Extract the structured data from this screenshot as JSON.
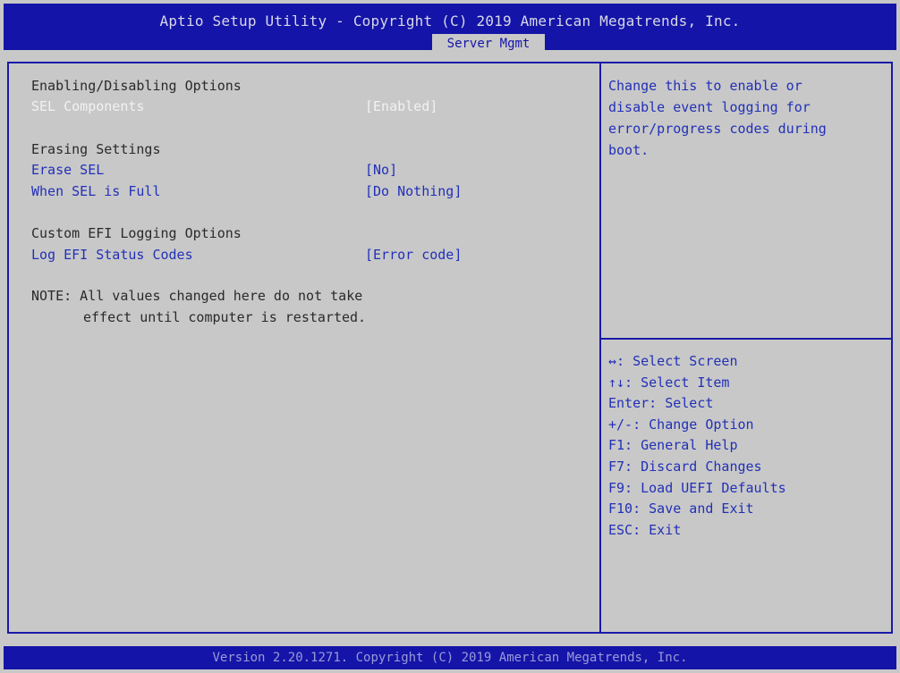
{
  "header": {
    "title": "Aptio Setup Utility - Copyright (C) 2019 American Megatrends, Inc.",
    "active_tab": "Server Mgmt"
  },
  "settings": {
    "section1_heading": "Enabling/Disabling Options",
    "sel_components_label": "SEL Components",
    "sel_components_value": "[Enabled]",
    "section2_heading": "Erasing Settings",
    "erase_sel_label": "Erase SEL",
    "erase_sel_value": "[No]",
    "when_full_label": "When SEL is Full",
    "when_full_value": "[Do Nothing]",
    "section3_heading": "Custom EFI Logging Options",
    "log_efi_label": "Log EFI Status Codes",
    "log_efi_value": "[Error code]",
    "note_line1": "NOTE: All values changed here do not take",
    "note_line2": "effect until computer is restarted."
  },
  "help": {
    "lines": [
      "Change this to enable or",
      "disable event logging for",
      "error/progress codes during",
      "boot."
    ]
  },
  "keys": [
    "↔: Select Screen",
    "↑↓: Select Item",
    "Enter: Select",
    "+/-: Change Option",
    "F1: General Help",
    "F7: Discard Changes",
    "F9: Load UEFI Defaults",
    "F10: Save and Exit",
    "ESC: Exit"
  ],
  "footer": {
    "text": "Version 2.20.1271. Copyright (C) 2019 American Megatrends, Inc."
  },
  "colors": {
    "bar_blue": "#1414a8",
    "panel_gray": "#c8c8c8",
    "item_blue": "#2230b8",
    "selected_text": "#f2f2f2"
  }
}
